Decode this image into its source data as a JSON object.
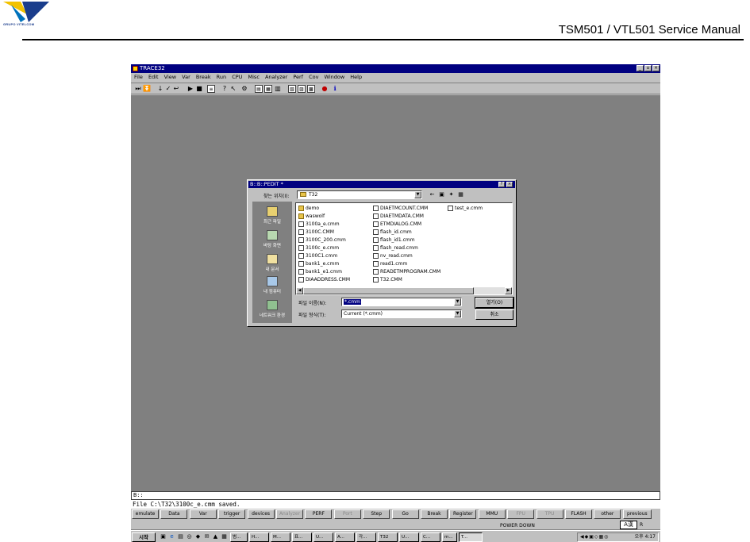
{
  "document": {
    "logo_text": "GRUPO VITELCOM",
    "title": "TSM501 / VTL501 Service Manual"
  },
  "window": {
    "title": "TRACE32",
    "menu": [
      "File",
      "Edit",
      "View",
      "Var",
      "Break",
      "Run",
      "CPU",
      "Misc",
      "Analyzer",
      "Perf",
      "Cov",
      "Window",
      "Help"
    ]
  },
  "dialog": {
    "title": "B::B::PEDIT *",
    "look_in_label": "찾는 위치(I):",
    "look_in_value": "T32",
    "places": [
      "최근 파일",
      "바탕 화면",
      "내 문서",
      "내 컴퓨터",
      "네트워크 환경"
    ],
    "files_col1": [
      {
        "name": "demo",
        "type": "folder"
      },
      {
        "name": "waswolf",
        "type": "folder"
      },
      {
        "name": "3100a_e.cmm",
        "type": "file"
      },
      {
        "name": "3100C.CMM",
        "type": "file"
      },
      {
        "name": "3100C_200.cmm",
        "type": "file"
      },
      {
        "name": "3100c_e.cmm",
        "type": "file"
      },
      {
        "name": "3100C1.cmm",
        "type": "file"
      },
      {
        "name": "bank1_e.cmm",
        "type": "file"
      },
      {
        "name": "bank1_e1.cmm",
        "type": "file"
      },
      {
        "name": "DIAADDRESS.CMM",
        "type": "file"
      }
    ],
    "files_col2": [
      {
        "name": "DIAETMCOUNT.CMM",
        "type": "file"
      },
      {
        "name": "DIAETMDATA.CMM",
        "type": "file"
      },
      {
        "name": "ETMDIALOG.CMM",
        "type": "file"
      },
      {
        "name": "flash_id.cmm",
        "type": "file"
      },
      {
        "name": "flash_id1.cmm",
        "type": "file"
      },
      {
        "name": "flash_read.cmm",
        "type": "file"
      },
      {
        "name": "nv_read.cmm",
        "type": "file"
      },
      {
        "name": "read1.cmm",
        "type": "file"
      },
      {
        "name": "READETMPROGRAM.CMM",
        "type": "file"
      },
      {
        "name": "T32.CMM",
        "type": "file"
      }
    ],
    "files_col3": [
      {
        "name": "test_e.cmm",
        "type": "file"
      }
    ],
    "filename_label": "파일 이름(N):",
    "filename_value": "*.cmm",
    "filetype_label": "파일 형식(T):",
    "filetype_value": "Current (*.cmm)",
    "open_button": "열기(O)",
    "cancel_button": "취소"
  },
  "command": {
    "prompt": "B::",
    "message": "File C:\\T32\\3100c_e.cmm saved."
  },
  "softkeys": [
    {
      "label": "emulate",
      "enabled": true
    },
    {
      "label": "Data",
      "enabled": true
    },
    {
      "label": "Var",
      "enabled": true
    },
    {
      "label": "trigger",
      "enabled": true
    },
    {
      "label": "devices",
      "enabled": true
    },
    {
      "label": "Analyzer",
      "enabled": false
    },
    {
      "label": "PERF",
      "enabled": true
    },
    {
      "label": "Port",
      "enabled": false
    },
    {
      "label": "Step",
      "enabled": true
    },
    {
      "label": "Go",
      "enabled": true
    },
    {
      "label": "Break",
      "enabled": true
    },
    {
      "label": "Register",
      "enabled": true
    },
    {
      "label": "MMU",
      "enabled": true
    },
    {
      "label": "FPU",
      "enabled": false
    },
    {
      "label": "TPU",
      "enabled": false
    },
    {
      "label": "FLASH",
      "enabled": true
    },
    {
      "label": "other",
      "enabled": true
    },
    {
      "label": "previous",
      "enabled": true
    }
  ],
  "status": {
    "power": "POWER DOWN",
    "ime": "A漢",
    "ime_suffix": "R"
  },
  "taskbar": {
    "start": "시작",
    "tasks": [
      "범...",
      "H...",
      "M...",
      "표...",
      "U...",
      "A...",
      "각...",
      "T32",
      "U...",
      "C...",
      "m...",
      "T..."
    ],
    "clock": "오후 4:17"
  },
  "colors": {
    "title_bar": "#000080",
    "workspace": "#808080",
    "chrome": "#c0c0c0"
  }
}
